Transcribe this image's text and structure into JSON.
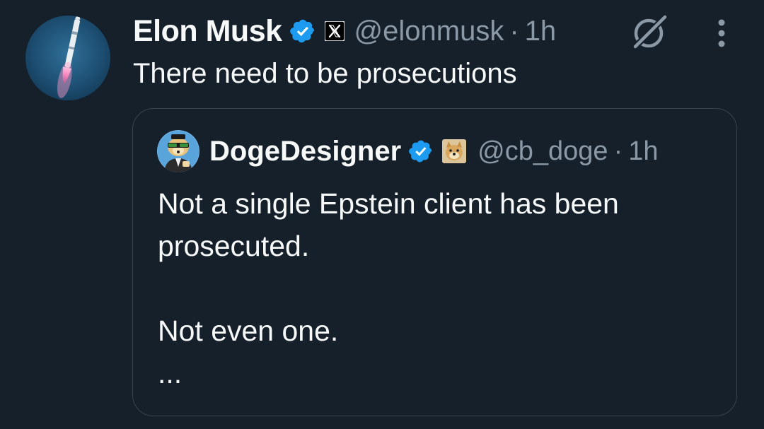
{
  "post": {
    "author_name": "Elon Musk",
    "handle": "@elonmusk",
    "separator": "·",
    "time": "1h",
    "text": "There need to be prosecutions",
    "avatar_icon": "rocket-launch-avatar",
    "verified_color": "#1d9bf0"
  },
  "quoted_post": {
    "author_name": "DogeDesigner",
    "handle": "@cb_doge",
    "separator": "·",
    "time": "1h",
    "line1": "Not a single Epstein client has been prosecuted.",
    "line2": "Not even one.",
    "truncation": "..."
  },
  "colors": {
    "background": "#15202b",
    "secondary_text": "#8b98a5",
    "border": "#38444d"
  }
}
